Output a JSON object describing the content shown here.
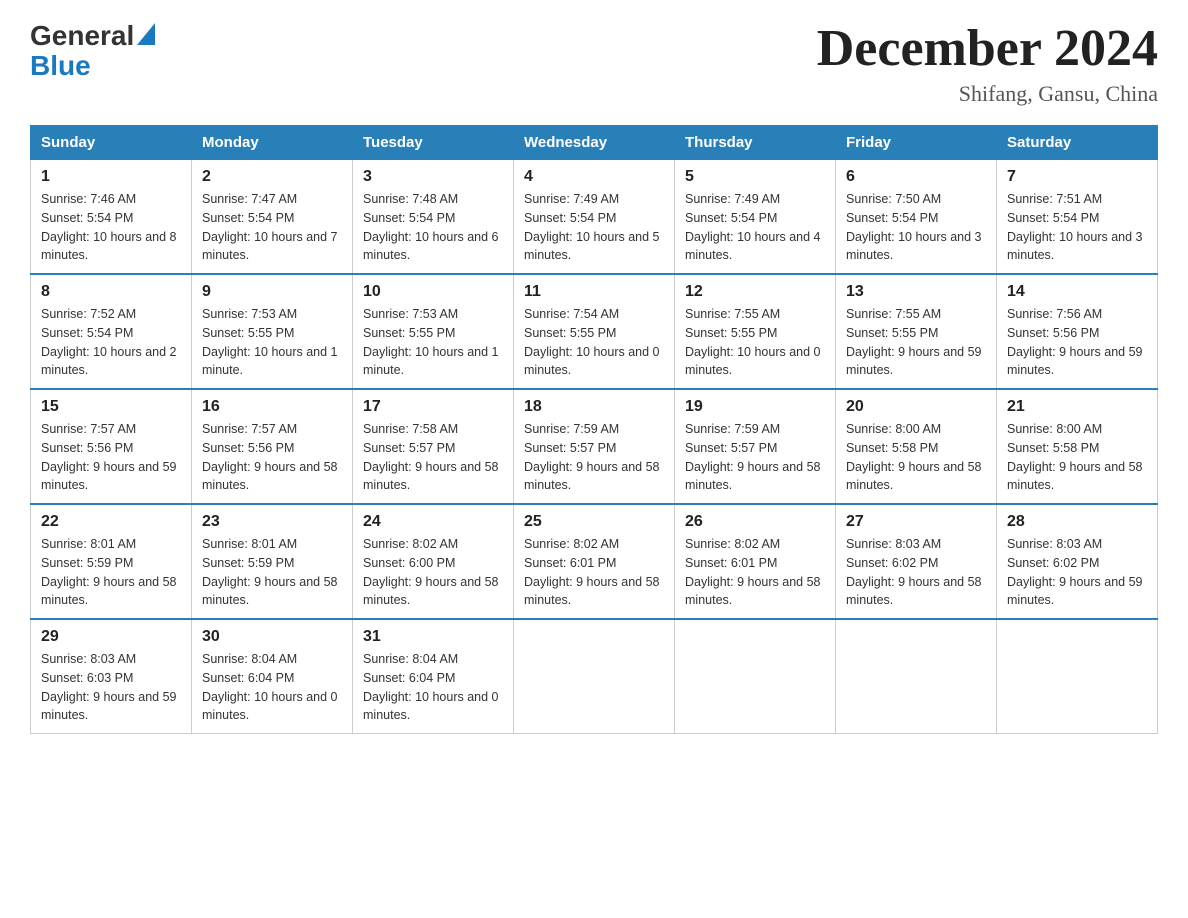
{
  "header": {
    "logo_general": "General",
    "logo_blue": "Blue",
    "month_title": "December 2024",
    "subtitle": "Shifang, Gansu, China"
  },
  "columns": [
    "Sunday",
    "Monday",
    "Tuesday",
    "Wednesday",
    "Thursday",
    "Friday",
    "Saturday"
  ],
  "weeks": [
    [
      {
        "day": "1",
        "sunrise": "7:46 AM",
        "sunset": "5:54 PM",
        "daylight": "10 hours and 8 minutes."
      },
      {
        "day": "2",
        "sunrise": "7:47 AM",
        "sunset": "5:54 PM",
        "daylight": "10 hours and 7 minutes."
      },
      {
        "day": "3",
        "sunrise": "7:48 AM",
        "sunset": "5:54 PM",
        "daylight": "10 hours and 6 minutes."
      },
      {
        "day": "4",
        "sunrise": "7:49 AM",
        "sunset": "5:54 PM",
        "daylight": "10 hours and 5 minutes."
      },
      {
        "day": "5",
        "sunrise": "7:49 AM",
        "sunset": "5:54 PM",
        "daylight": "10 hours and 4 minutes."
      },
      {
        "day": "6",
        "sunrise": "7:50 AM",
        "sunset": "5:54 PM",
        "daylight": "10 hours and 3 minutes."
      },
      {
        "day": "7",
        "sunrise": "7:51 AM",
        "sunset": "5:54 PM",
        "daylight": "10 hours and 3 minutes."
      }
    ],
    [
      {
        "day": "8",
        "sunrise": "7:52 AM",
        "sunset": "5:54 PM",
        "daylight": "10 hours and 2 minutes."
      },
      {
        "day": "9",
        "sunrise": "7:53 AM",
        "sunset": "5:55 PM",
        "daylight": "10 hours and 1 minute."
      },
      {
        "day": "10",
        "sunrise": "7:53 AM",
        "sunset": "5:55 PM",
        "daylight": "10 hours and 1 minute."
      },
      {
        "day": "11",
        "sunrise": "7:54 AM",
        "sunset": "5:55 PM",
        "daylight": "10 hours and 0 minutes."
      },
      {
        "day": "12",
        "sunrise": "7:55 AM",
        "sunset": "5:55 PM",
        "daylight": "10 hours and 0 minutes."
      },
      {
        "day": "13",
        "sunrise": "7:55 AM",
        "sunset": "5:55 PM",
        "daylight": "9 hours and 59 minutes."
      },
      {
        "day": "14",
        "sunrise": "7:56 AM",
        "sunset": "5:56 PM",
        "daylight": "9 hours and 59 minutes."
      }
    ],
    [
      {
        "day": "15",
        "sunrise": "7:57 AM",
        "sunset": "5:56 PM",
        "daylight": "9 hours and 59 minutes."
      },
      {
        "day": "16",
        "sunrise": "7:57 AM",
        "sunset": "5:56 PM",
        "daylight": "9 hours and 58 minutes."
      },
      {
        "day": "17",
        "sunrise": "7:58 AM",
        "sunset": "5:57 PM",
        "daylight": "9 hours and 58 minutes."
      },
      {
        "day": "18",
        "sunrise": "7:59 AM",
        "sunset": "5:57 PM",
        "daylight": "9 hours and 58 minutes."
      },
      {
        "day": "19",
        "sunrise": "7:59 AM",
        "sunset": "5:57 PM",
        "daylight": "9 hours and 58 minutes."
      },
      {
        "day": "20",
        "sunrise": "8:00 AM",
        "sunset": "5:58 PM",
        "daylight": "9 hours and 58 minutes."
      },
      {
        "day": "21",
        "sunrise": "8:00 AM",
        "sunset": "5:58 PM",
        "daylight": "9 hours and 58 minutes."
      }
    ],
    [
      {
        "day": "22",
        "sunrise": "8:01 AM",
        "sunset": "5:59 PM",
        "daylight": "9 hours and 58 minutes."
      },
      {
        "day": "23",
        "sunrise": "8:01 AM",
        "sunset": "5:59 PM",
        "daylight": "9 hours and 58 minutes."
      },
      {
        "day": "24",
        "sunrise": "8:02 AM",
        "sunset": "6:00 PM",
        "daylight": "9 hours and 58 minutes."
      },
      {
        "day": "25",
        "sunrise": "8:02 AM",
        "sunset": "6:01 PM",
        "daylight": "9 hours and 58 minutes."
      },
      {
        "day": "26",
        "sunrise": "8:02 AM",
        "sunset": "6:01 PM",
        "daylight": "9 hours and 58 minutes."
      },
      {
        "day": "27",
        "sunrise": "8:03 AM",
        "sunset": "6:02 PM",
        "daylight": "9 hours and 58 minutes."
      },
      {
        "day": "28",
        "sunrise": "8:03 AM",
        "sunset": "6:02 PM",
        "daylight": "9 hours and 59 minutes."
      }
    ],
    [
      {
        "day": "29",
        "sunrise": "8:03 AM",
        "sunset": "6:03 PM",
        "daylight": "9 hours and 59 minutes."
      },
      {
        "day": "30",
        "sunrise": "8:04 AM",
        "sunset": "6:04 PM",
        "daylight": "10 hours and 0 minutes."
      },
      {
        "day": "31",
        "sunrise": "8:04 AM",
        "sunset": "6:04 PM",
        "daylight": "10 hours and 0 minutes."
      },
      null,
      null,
      null,
      null
    ]
  ],
  "labels": {
    "sunrise_prefix": "Sunrise: ",
    "sunset_prefix": "Sunset: ",
    "daylight_prefix": "Daylight: "
  }
}
